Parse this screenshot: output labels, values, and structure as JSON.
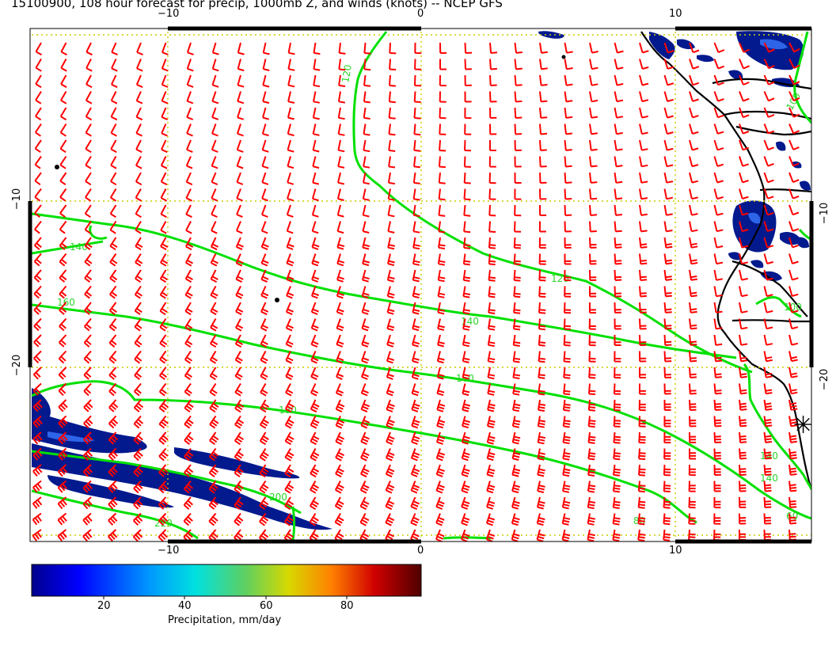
{
  "title": "15100900, 108 hour forecast for precip, 1000mb Z, and winds (knots) -- NCEP GFS",
  "axes": {
    "top_labels": [
      "−10",
      "0",
      "10"
    ],
    "bottom_labels": [
      "−10",
      "0",
      "10"
    ],
    "left_labels": [
      "−10",
      "−20"
    ],
    "right_labels": [
      "−10",
      "−20"
    ]
  },
  "contours": [
    {
      "label": "120",
      "value": 120
    },
    {
      "label": "140",
      "value": 140
    },
    {
      "label": "160",
      "value": 160
    },
    {
      "label": "180",
      "value": 180
    },
    {
      "label": "200",
      "value": 200
    },
    {
      "label": "220",
      "value": 220
    },
    {
      "label": "100",
      "value": 100
    },
    {
      "label": "80",
      "value": 80
    },
    {
      "label": "60",
      "value": 60
    }
  ],
  "colorbar": {
    "title": "Precipitation, mm/day",
    "ticks": [
      "20",
      "40",
      "60",
      "80"
    ],
    "colors": [
      "#00008c",
      "#0000ff",
      "#0096ff",
      "#00e0e0",
      "#60d060",
      "#d8d800",
      "#ff8000",
      "#d00000",
      "#500000"
    ]
  },
  "colors": {
    "contour": "#00e000",
    "contour_label": "#2ad42a",
    "wind_barb": "#ff0000",
    "grid": "#cccc00",
    "coast": "#000000",
    "precip": "#001a8c"
  },
  "marker": "✳"
}
